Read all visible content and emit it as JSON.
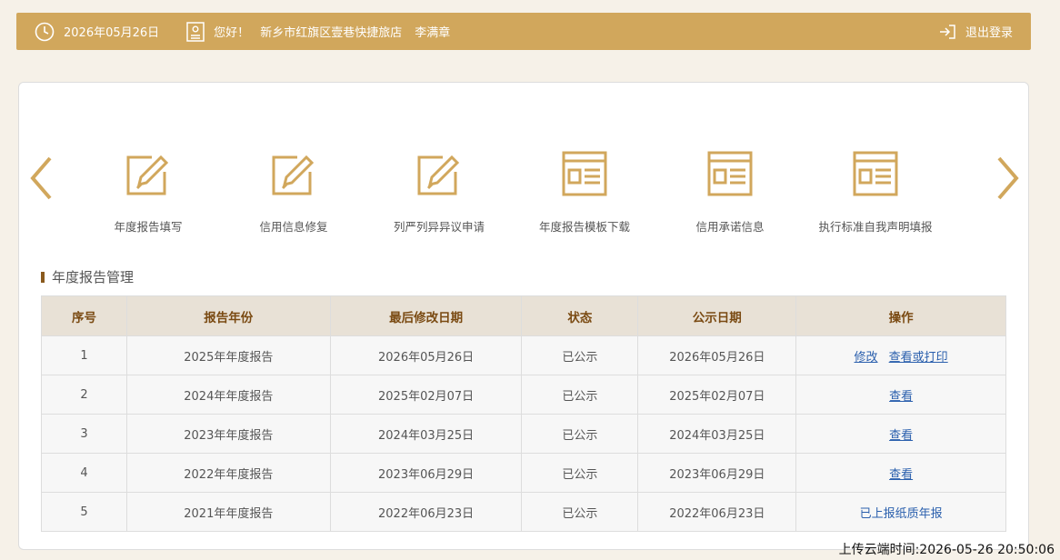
{
  "header": {
    "date": "2026年05月26日",
    "greeting": "您好！",
    "shop_name": "新乡市红旗区壹巷快捷旅店",
    "user_name": "李满章",
    "logout_label": "退出登录"
  },
  "quick_links": [
    {
      "label": "年度报告填写",
      "icon": "edit-icon"
    },
    {
      "label": "信用信息修复",
      "icon": "edit-icon"
    },
    {
      "label": "列严列异异议申请",
      "icon": "edit-icon"
    },
    {
      "label": "年度报告模板下载",
      "icon": "document-icon"
    },
    {
      "label": "信用承诺信息",
      "icon": "document-icon"
    },
    {
      "label": "执行标准自我声明填报",
      "icon": "document-icon"
    }
  ],
  "section": {
    "title": "年度报告管理"
  },
  "table": {
    "headers": [
      "序号",
      "报告年份",
      "最后修改日期",
      "状态",
      "公示日期",
      "操作"
    ],
    "rows": [
      {
        "no": "1",
        "year": "2025年年度报告",
        "modified": "2026年05月26日",
        "status": "已公示",
        "published": "2026年05月26日",
        "actions": [
          "修改",
          "查看或打印"
        ]
      },
      {
        "no": "2",
        "year": "2024年年度报告",
        "modified": "2025年02月07日",
        "status": "已公示",
        "published": "2025年02月07日",
        "actions": [
          "查看"
        ]
      },
      {
        "no": "3",
        "year": "2023年年度报告",
        "modified": "2024年03月25日",
        "status": "已公示",
        "published": "2024年03月25日",
        "actions": [
          "查看"
        ]
      },
      {
        "no": "4",
        "year": "2022年年度报告",
        "modified": "2023年06月29日",
        "status": "已公示",
        "published": "2023年06月29日",
        "actions": [
          "查看"
        ]
      },
      {
        "no": "5",
        "year": "2021年年度报告",
        "modified": "2022年06月23日",
        "status": "已公示",
        "published": "2022年06月23日",
        "note": "已上报纸质年报"
      }
    ]
  },
  "footer": {
    "upload_time": "上传云端时间:2026-05-26 20:50:06"
  },
  "colors": {
    "accent": "#d1a75c",
    "header_text": "#7a4a12",
    "link": "#2a5fad"
  }
}
